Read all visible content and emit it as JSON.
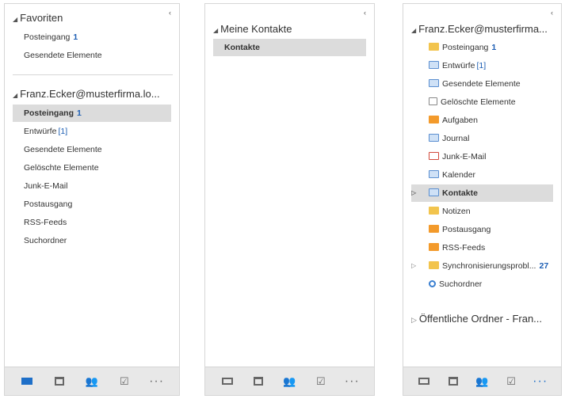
{
  "collapse_glyph": "‹",
  "pane1": {
    "favorites_header": "Favoriten",
    "favorites": [
      {
        "label": "Posteingang",
        "count": "1"
      },
      {
        "label": "Gesendete Elemente"
      }
    ],
    "account_header": "Franz.Ecker@musterfirma.lo...",
    "folders": [
      {
        "label": "Posteingang",
        "count": "1"
      },
      {
        "label": "Entwürfe",
        "bracket": "[1]"
      },
      {
        "label": "Gesendete Elemente"
      },
      {
        "label": "Gelöschte Elemente"
      },
      {
        "label": "Junk-E-Mail"
      },
      {
        "label": "Postausgang"
      },
      {
        "label": "RSS-Feeds"
      },
      {
        "label": "Suchordner"
      }
    ]
  },
  "pane2": {
    "header": "Meine Kontakte",
    "items": [
      {
        "label": "Kontakte"
      }
    ]
  },
  "pane3": {
    "account_header": "Franz.Ecker@musterfirma...",
    "folders": [
      {
        "label": "Posteingang",
        "count": "1",
        "icon": "inbox-icon"
      },
      {
        "label": "Entwürfe",
        "bracket": "[1]",
        "icon": "drafts-icon"
      },
      {
        "label": "Gesendete Elemente",
        "icon": "sent-icon"
      },
      {
        "label": "Gelöschte Elemente",
        "icon": "trash-icon"
      },
      {
        "label": "Aufgaben",
        "icon": "tasks-icon"
      },
      {
        "label": "Journal",
        "icon": "journal-icon"
      },
      {
        "label": "Junk-E-Mail",
        "icon": "junk-icon"
      },
      {
        "label": "Kalender",
        "icon": "calendar-icon"
      },
      {
        "label": "Kontakte",
        "icon": "contacts-icon"
      },
      {
        "label": "Notizen",
        "icon": "notes-icon"
      },
      {
        "label": "Postausgang",
        "icon": "outbox-icon"
      },
      {
        "label": "RSS-Feeds",
        "icon": "rss-icon"
      },
      {
        "label": "Synchronisierungsprobl...",
        "count": "27",
        "icon": "folder-icon"
      },
      {
        "label": "Suchordner",
        "icon": "search-folder-icon"
      }
    ],
    "public_header": "Öffentliche Ordner - Fran..."
  },
  "nav_icons": [
    "mail-icon",
    "calendar-icon",
    "people-icon",
    "tasks-icon",
    "more-icon"
  ],
  "nav_more_glyph": "···",
  "colors": {
    "accent": "#1e6fc8",
    "count_blue": "#1e5fb4",
    "selection": "#dcdcdc"
  }
}
